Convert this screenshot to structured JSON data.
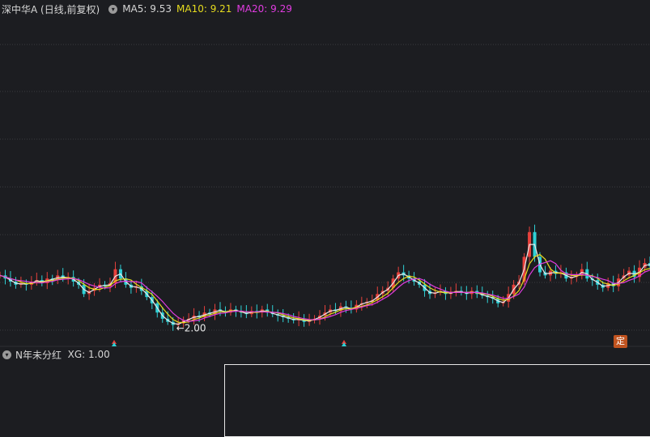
{
  "legend": {
    "title": "深中华A (日线,前复权)",
    "ma5": {
      "label": "MA5:",
      "value": "9.53",
      "color": "#e8e8e8"
    },
    "ma10": {
      "label": "MA10:",
      "value": "9.21",
      "color": "#e6dc1e"
    },
    "ma20": {
      "label": "MA20:",
      "value": "9.29",
      "color": "#e03ce0"
    }
  },
  "indicator": {
    "title": "N年未分红",
    "xg_label": "XG:",
    "xg_value": "1.00"
  },
  "badge_label": "定",
  "colors": {
    "background": "#1c1d21",
    "grid": "#3a3b40",
    "up": "#e8413c",
    "down": "#2fd1d6",
    "white_line": "#e8e8e8"
  },
  "chart_data": {
    "type": "candlestick",
    "ylim": [
      1.7,
      12.5
    ],
    "min_annotation": {
      "label": "←2.00",
      "value": 2.0
    },
    "close_series": [
      3.6,
      3.5,
      3.4,
      3.3,
      3.35,
      3.3,
      3.4,
      3.45,
      3.35,
      3.5,
      3.45,
      3.6,
      3.5,
      3.55,
      3.4,
      3.3,
      3.0,
      3.1,
      3.2,
      3.3,
      3.25,
      3.35,
      3.8,
      3.5,
      3.3,
      3.2,
      3.25,
      3.1,
      2.9,
      2.7,
      2.4,
      2.2,
      2.1,
      2.0,
      2.05,
      2.15,
      2.2,
      2.3,
      2.25,
      2.4,
      2.35,
      2.5,
      2.45,
      2.4,
      2.5,
      2.45,
      2.4,
      2.35,
      2.45,
      2.4,
      2.5,
      2.4,
      2.35,
      2.3,
      2.25,
      2.2,
      2.15,
      2.2,
      2.1,
      2.15,
      2.2,
      2.3,
      2.4,
      2.5,
      2.45,
      2.6,
      2.55,
      2.5,
      2.65,
      2.7,
      2.75,
      2.8,
      3.0,
      3.1,
      3.2,
      3.5,
      3.7,
      3.6,
      3.5,
      3.4,
      3.3,
      3.1,
      3.0,
      3.05,
      3.1,
      3.0,
      3.05,
      3.1,
      3.05,
      3.0,
      3.1,
      3.0,
      2.95,
      2.9,
      2.85,
      2.7,
      2.75,
      3.0,
      3.3,
      3.4,
      4.2,
      5.0,
      4.2,
      3.7,
      3.6,
      3.75,
      3.65,
      3.7,
      3.5,
      3.55,
      3.6,
      3.8,
      3.5,
      3.45,
      3.3,
      3.2,
      3.35,
      3.25,
      3.5,
      3.6,
      3.75,
      3.55,
      3.85,
      4.0,
      3.9
    ],
    "bottom_markers": [
      141,
      425
    ]
  }
}
